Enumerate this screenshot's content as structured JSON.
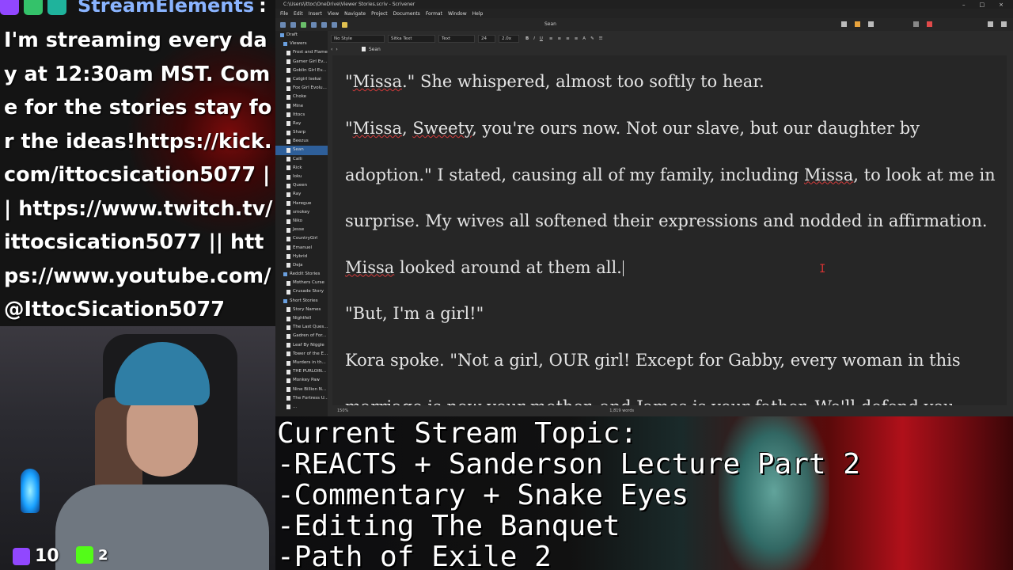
{
  "chat": {
    "username": "StreamElements",
    "colon": ":",
    "message": "I'm streaming every day at 12:30am MST. Come for the stories stay for the ideas!https://kick.com/ittocsication5077 || https://www.twitch.tv/ittocsication5077 || https://www.youtube.com/@IttocSication5077",
    "icons": [
      "twitch-icon",
      "checkmark-icon",
      "streamelements-icon"
    ]
  },
  "webcam": {
    "twitch_count": "10",
    "kick_count": "2",
    "colors": {
      "twitch": "#9147ff",
      "kick": "#53fc18"
    }
  },
  "app": {
    "title": "C:\\Users\\ittoc\\OneDrive\\Viewer Stories.scriv - Scrivener",
    "menu": [
      "File",
      "Edit",
      "Insert",
      "View",
      "Navigate",
      "Project",
      "Documents",
      "Format",
      "Window",
      "Help"
    ],
    "document_title": "Sean",
    "format_bar": {
      "style": "No Style",
      "font": "Sitka Text",
      "face": "Text",
      "size": "24",
      "spacing": "2.0x"
    },
    "header_doc": "Sean",
    "binder": [
      {
        "label": "Draft",
        "type": "folder",
        "level": 0
      },
      {
        "label": "Viewers",
        "type": "folder",
        "level": 1
      },
      {
        "label": "Frost and Flame",
        "type": "doc",
        "level": 2
      },
      {
        "label": "Gamer Girl Ev...",
        "type": "doc",
        "level": 2
      },
      {
        "label": "Goblin Girl Ev...",
        "type": "doc",
        "level": 2
      },
      {
        "label": "Catgirl Isekai",
        "type": "doc",
        "level": 2
      },
      {
        "label": "Fox Girl Evolu...",
        "type": "doc",
        "level": 2
      },
      {
        "label": "Choke",
        "type": "doc",
        "level": 2
      },
      {
        "label": "Mine",
        "type": "doc",
        "level": 2
      },
      {
        "label": "Ittocs",
        "type": "doc",
        "level": 2
      },
      {
        "label": "Ray",
        "type": "doc",
        "level": 2
      },
      {
        "label": "Sharp",
        "type": "doc",
        "level": 2
      },
      {
        "label": "Beezus",
        "type": "doc",
        "level": 2
      },
      {
        "label": "Sean",
        "type": "doc",
        "level": 2,
        "selected": true
      },
      {
        "label": "Calli",
        "type": "doc",
        "level": 2
      },
      {
        "label": "Rick",
        "type": "doc",
        "level": 2
      },
      {
        "label": "Ioku",
        "type": "doc",
        "level": 2
      },
      {
        "label": "Queen",
        "type": "doc",
        "level": 2
      },
      {
        "label": "Ray",
        "type": "doc",
        "level": 2
      },
      {
        "label": "Haregue",
        "type": "doc",
        "level": 2
      },
      {
        "label": "smokey",
        "type": "doc",
        "level": 2
      },
      {
        "label": "Niko",
        "type": "doc",
        "level": 2
      },
      {
        "label": "Jesse",
        "type": "doc",
        "level": 2
      },
      {
        "label": "CountryGirl",
        "type": "doc",
        "level": 2
      },
      {
        "label": "Emanuel",
        "type": "doc",
        "level": 2
      },
      {
        "label": "Hybrid",
        "type": "doc",
        "level": 2
      },
      {
        "label": "Deja",
        "type": "doc",
        "level": 2
      },
      {
        "label": "Reddit Stories",
        "type": "folder",
        "level": 1
      },
      {
        "label": "Mothers Curse",
        "type": "doc",
        "level": 2
      },
      {
        "label": "Crusade Story",
        "type": "doc",
        "level": 2
      },
      {
        "label": "Short Stories",
        "type": "folder",
        "level": 1
      },
      {
        "label": "Story Names",
        "type": "doc",
        "level": 2
      },
      {
        "label": "Nightfell",
        "type": "doc",
        "level": 2
      },
      {
        "label": "The Last Ques...",
        "type": "doc",
        "level": 2
      },
      {
        "label": "Gadren of For...",
        "type": "doc",
        "level": 2
      },
      {
        "label": "Leaf By Niggle",
        "type": "doc",
        "level": 2
      },
      {
        "label": "Tower of the E...",
        "type": "doc",
        "level": 2
      },
      {
        "label": "Murders in th...",
        "type": "doc",
        "level": 2
      },
      {
        "label": "THE PURLOIN...",
        "type": "doc",
        "level": 2
      },
      {
        "label": "Monkey Paw",
        "type": "doc",
        "level": 2
      },
      {
        "label": "Nine Billion N...",
        "type": "doc",
        "level": 2
      },
      {
        "label": "The Fortress U...",
        "type": "doc",
        "level": 2
      },
      {
        "label": "...",
        "type": "doc",
        "level": 2
      }
    ],
    "editor": {
      "p1": [
        "\"",
        "Missa",
        ".\" She whispered, almost too softly to hear."
      ],
      "p2": [
        "\"",
        "Missa",
        ", ",
        "Sweety",
        ", you're ours now. Not our slave, but our daughter by adoption.\" I stated, causing all of my family, including ",
        "Missa",
        ", to look at me in surprise. My wives all softened their expressions and nodded in affirmation. ",
        "Missa",
        " looked around at them all."
      ],
      "p3": "\"But, I'm a girl!\"",
      "p4": "Kora spoke. \"Not a girl, OUR girl! Except for Gabby, every woman in this marriage is now your mother, and James is your father. We'll defend you"
    },
    "status": {
      "zoom": "150%",
      "word_count": "1,819 words"
    }
  },
  "topic": {
    "lines": [
      "Current Stream Topic:",
      "-REACTS + Sanderson Lecture Part 2",
      "-Commentary + Snake Eyes",
      "-Editing The Banquet",
      "-Path of Exile 2"
    ]
  }
}
